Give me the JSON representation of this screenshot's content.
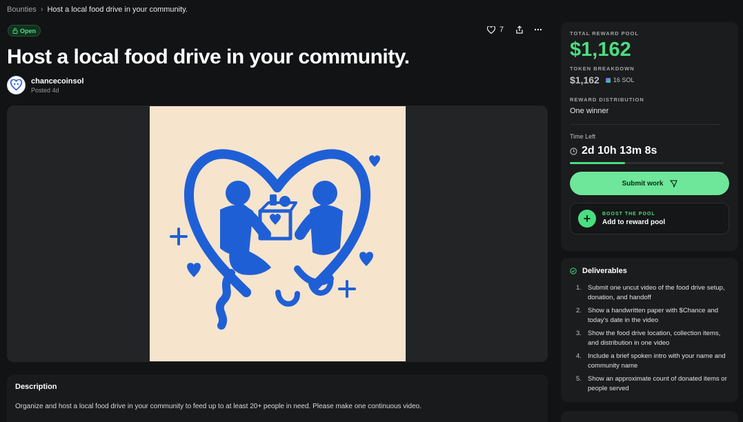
{
  "breadcrumb": {
    "root": "Bounties",
    "current": "Host a local food drive in your community."
  },
  "status": "Open",
  "likes": "7",
  "title": "Host a local food drive in your community.",
  "author": {
    "name": "chancecoinsol",
    "posted": "Posted 4d"
  },
  "description": {
    "heading": "Description",
    "text": "Organize and host a local food drive in your community to feed up to at least 20+ people in need. Please make one continuous video."
  },
  "reward": {
    "pool_label": "TOTAL REWARD POOL",
    "pool_value": "$1,162",
    "token_label": "TOKEN BREAKDOWN",
    "token_usd": "$1,162",
    "token_sol": "16 SOL",
    "dist_label": "REWARD DISTRIBUTION",
    "dist_value": "One winner",
    "time_label": "Time Left",
    "time_value": "2d 10h 13m 8s",
    "time_progress": 0.36,
    "submit_label": "Submit work",
    "boost_kicker": "BOOST THE POOL",
    "boost_label": "Add to reward pool"
  },
  "deliverables": {
    "heading": "Deliverables",
    "items": [
      {
        "n": "1.",
        "text": "Submit one uncut video of the food drive setup, donation, and handoff"
      },
      {
        "n": "2.",
        "text": "Show a handwritten paper with $Chance and today's date in the video"
      },
      {
        "n": "3.",
        "text": "Show the food drive location, collection items, and distribution in one video"
      },
      {
        "n": "4.",
        "text": "Include a brief spoken intro with your name and community name"
      },
      {
        "n": "5.",
        "text": "Show an approximate count of donated items or people served"
      }
    ]
  },
  "colors": {
    "accent": "#4ade80",
    "background": "#121314",
    "card": "#1b1c1d",
    "art_blue": "#1f5fd6",
    "art_bg": "#f6e4cd"
  }
}
